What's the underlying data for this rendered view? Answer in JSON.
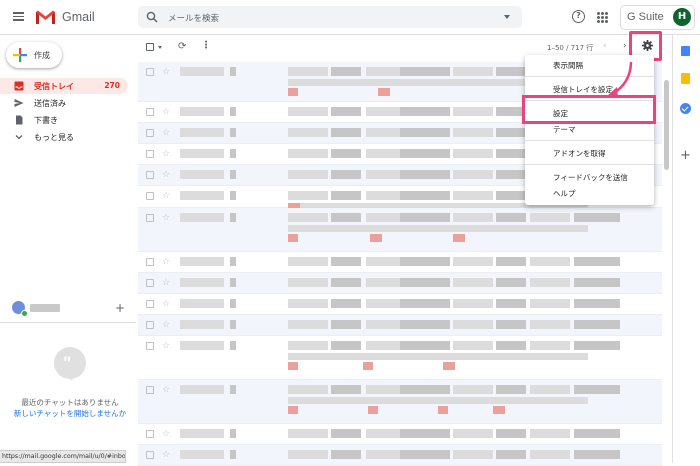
{
  "app": {
    "brand": "Gmail",
    "suite_label": "G Suite",
    "avatar_letter": "H"
  },
  "search": {
    "placeholder": "メールを検索"
  },
  "compose": {
    "label": "作成"
  },
  "nav": [
    {
      "label": "受信トレイ",
      "count": "270",
      "icon": "inbox-icon",
      "active": true
    },
    {
      "label": "送信済み",
      "icon": "send-icon"
    },
    {
      "label": "下書き",
      "icon": "draft-icon"
    },
    {
      "label": "もっと見る",
      "icon": "chevron-down-icon"
    }
  ],
  "chat": {
    "no_recent": "最近のチャットはありません",
    "start_new": "新しいチャットを開始しませんか"
  },
  "status_url": "https://mail.google.com/mail/u/0/#inbox",
  "pager": {
    "range": "1–50 / 717 行"
  },
  "menu": {
    "items": [
      {
        "label": "表示間隔"
      },
      {
        "label": "受信トレイを設定"
      },
      {
        "label": "設定",
        "highlighted": true
      },
      {
        "label": "テーマ"
      },
      {
        "label": "アドオンを取得"
      },
      {
        "label": "フィードバックを送信"
      },
      {
        "label": "ヘルプ"
      }
    ]
  },
  "colors": {
    "accent": "#d93025",
    "highlight": "#e8457c",
    "avatar": "#0d652d"
  }
}
